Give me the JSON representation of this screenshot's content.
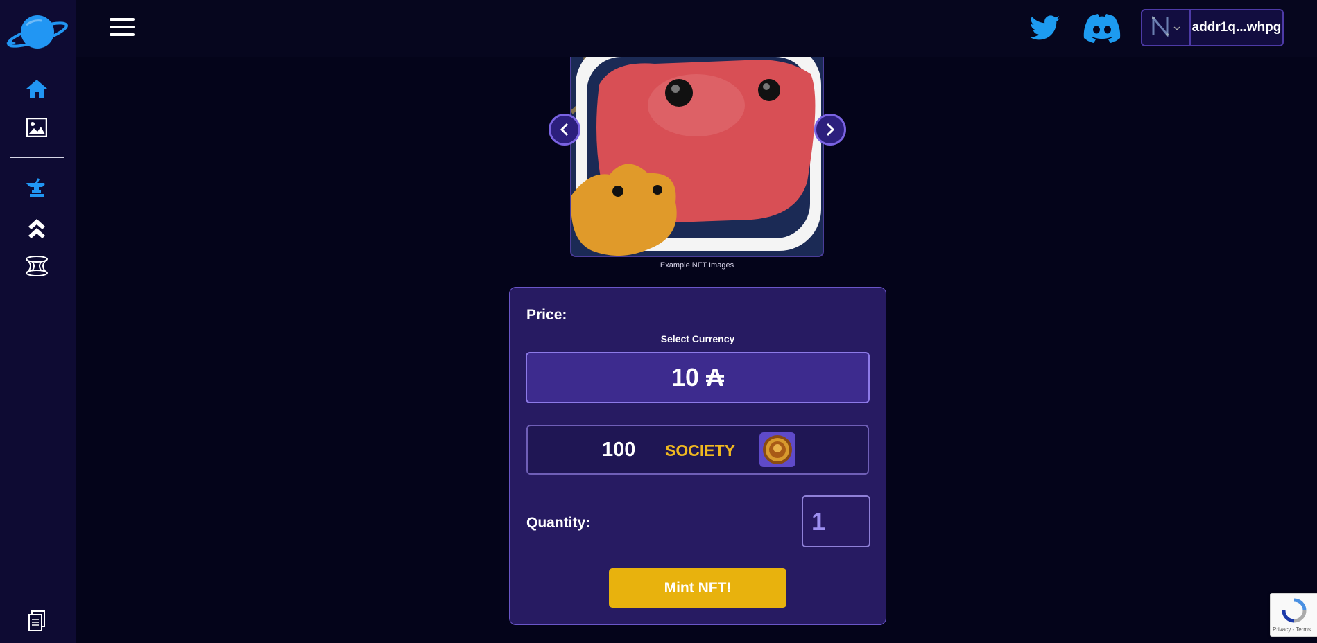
{
  "header": {
    "wallet_address": "addr1q...whpg"
  },
  "carousel": {
    "caption": "Example NFT Images"
  },
  "mint_card": {
    "price_label": "Price:",
    "select_currency_label": "Select Currency",
    "options": [
      {
        "amount": "10 ₳",
        "selected": true
      },
      {
        "amount": "100",
        "symbol": "SOCIETY",
        "selected": false
      }
    ],
    "quantity_label": "Quantity:",
    "quantity_value": "1",
    "mint_button": "Mint NFT!"
  },
  "recaptcha": {
    "terms": "Privacy - Terms"
  },
  "colors": {
    "background": "#04041a",
    "sidebar": "#0e0b33",
    "card": "#271b62",
    "accent": "#e8b20d",
    "icon_blue": "#2196f3",
    "society_gold": "#f0b820"
  },
  "icons": [
    "planet-logo-icon",
    "home-icon",
    "image-icon",
    "anvil-icon",
    "double-chevron-up-icon",
    "wormhole-icon",
    "documents-icon",
    "hamburger-icon",
    "twitter-icon",
    "discord-icon",
    "wallet-n-logo-icon",
    "chevron-down-icon"
  ]
}
